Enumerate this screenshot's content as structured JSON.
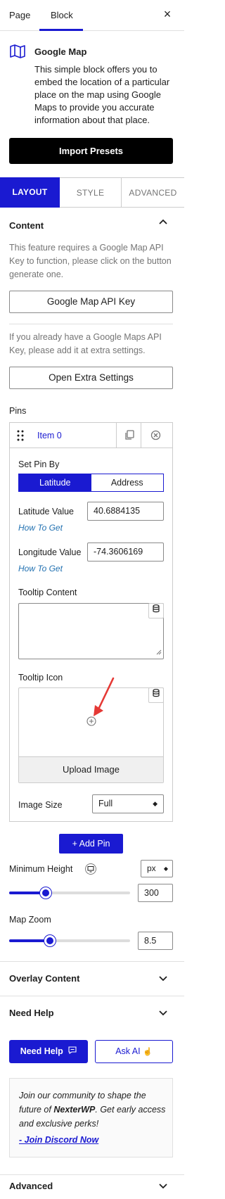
{
  "tabs": {
    "page": "Page",
    "block": "Block",
    "close": "×"
  },
  "block": {
    "title": "Google Map",
    "description": "This simple block offers you to embed the location of a particular place on the map using Google Maps to provide you accurate information about that place.",
    "import_presets": "Import Presets"
  },
  "layout_tabs": [
    "LAYOUT",
    "STYLE",
    "ADVANCED"
  ],
  "content": {
    "title": "Content",
    "api_hint": "This feature requires a Google Map API Key to function, please click on the button generate one.",
    "api_button": "Google Map API Key",
    "extra_hint": "If you already have a Google Maps API Key, please add it at extra settings.",
    "extra_button": "Open Extra Settings"
  },
  "pins": {
    "title": "Pins",
    "item_label": "Item 0",
    "set_pin_by": "Set Pin By",
    "options": [
      "Latitude",
      "Address"
    ],
    "latitude_label": "Latitude Value",
    "latitude_value": "40.6884135",
    "longitude_label": "Longitude Value",
    "longitude_value": "-74.3606169",
    "how_to_get": "How To Get",
    "tooltip_content": "Tooltip Content",
    "tooltip_icon": "Tooltip Icon",
    "upload_image": "Upload Image",
    "image_size_label": "Image Size",
    "image_size_value": "Full",
    "add_pin": "+ Add Pin"
  },
  "min_height": {
    "label": "Minimum Height",
    "unit": "px",
    "value": "300",
    "fraction": 0.3
  },
  "map_zoom": {
    "label": "Map Zoom",
    "value": "8.5",
    "fraction": 0.34
  },
  "sections": {
    "overlay": "Overlay Content",
    "need_help": "Need Help",
    "advanced": "Advanced"
  },
  "help": {
    "need_help_button": "Need Help",
    "ask_ai_button": "Ask AI",
    "community_text_1": "Join our community to shape the future of ",
    "community_brand": "NexterWP",
    "community_text_2": ". Get early access and exclusive perks!",
    "discord_link": "- Join Discord Now"
  },
  "colors": {
    "accent": "#1a1ad1",
    "link": "#2271b1",
    "arrow": "#e53935"
  }
}
